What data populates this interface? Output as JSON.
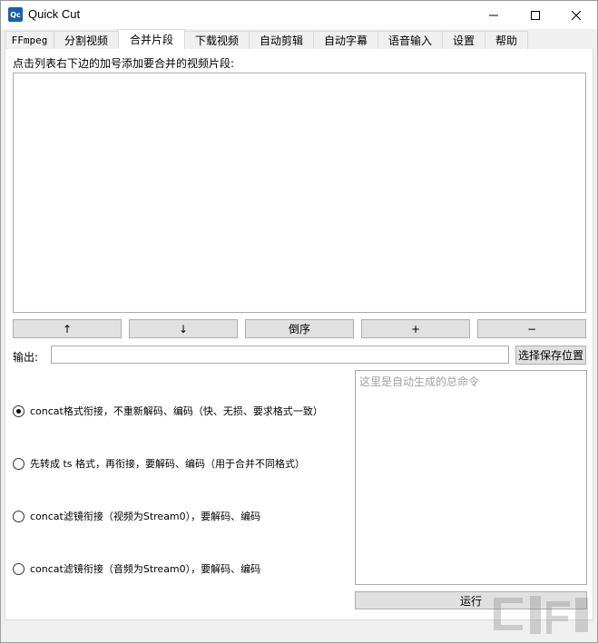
{
  "window": {
    "title": "Quick Cut",
    "icon_text": "Qc"
  },
  "tabs": [
    {
      "label": "FFmpeg",
      "active": false
    },
    {
      "label": "分割视频",
      "active": false
    },
    {
      "label": "合并片段",
      "active": true
    },
    {
      "label": "下载视频",
      "active": false
    },
    {
      "label": "自动剪辑",
      "active": false
    },
    {
      "label": "自动字幕",
      "active": false
    },
    {
      "label": "语音输入",
      "active": false
    },
    {
      "label": "设置",
      "active": false
    },
    {
      "label": "帮助",
      "active": false
    }
  ],
  "merge": {
    "instruction": "点击列表右下边的加号添加要合并的视频片段:",
    "buttons": {
      "up": "↑",
      "down": "↓",
      "reverse": "倒序",
      "add": "+",
      "remove": "−"
    },
    "output_label": "输出:",
    "output_value": "",
    "save_location": "选择保存位置",
    "options": [
      {
        "label": "concat格式衔接，不重新解码、编码（快、无损、要求格式一致）",
        "checked": true
      },
      {
        "label": "先转成 ts 格式，再衔接，要解码、编码（用于合并不同格式）",
        "checked": false
      },
      {
        "label": "concat滤镜衔接（视频为Stream0），要解码、编码",
        "checked": false
      },
      {
        "label": "concat滤镜衔接（音频为Stream0），要解码、编码",
        "checked": false
      }
    ],
    "command_placeholder": "这里是自动生成的总命令",
    "run": "运行"
  },
  "colors": {
    "window_bg": "#f0f0f0",
    "panel_bg": "#ffffff",
    "button_bg": "#e1e1e1",
    "border": "#aaaaaa",
    "icon_blue": "#1b5fa8"
  }
}
